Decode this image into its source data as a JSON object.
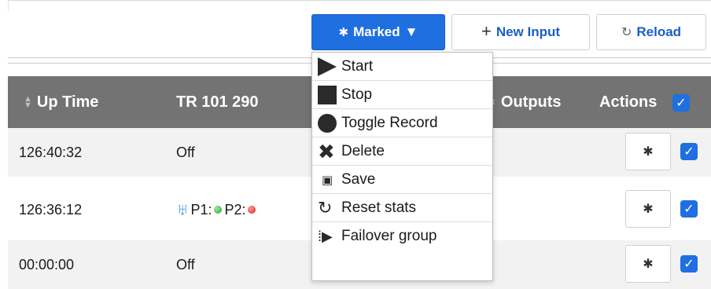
{
  "toolbar": {
    "marked_label": "Marked",
    "new_input_label": "New Input",
    "reload_label": "Reload"
  },
  "table": {
    "headers": {
      "uptime": "Up Time",
      "tr101290": "TR 101 290",
      "outputs": "Outputs",
      "actions": "Actions"
    },
    "rows": [
      {
        "uptime": "126:40:32",
        "tr101290": "Off",
        "checked": true
      },
      {
        "uptime": "126:36:12",
        "tr_p1": "P1:",
        "tr_p2": "P2:",
        "p1_status": "green",
        "p2_status": "red",
        "checked": true
      },
      {
        "uptime": "00:00:00",
        "tr101290": "Off",
        "checked": true
      }
    ]
  },
  "menu": {
    "items": [
      {
        "label": "Start",
        "icon": "play-icon"
      },
      {
        "label": "Stop",
        "icon": "stop-icon"
      },
      {
        "label": "Toggle Record",
        "icon": "record-icon"
      },
      {
        "label": "Delete",
        "icon": "delete-icon"
      },
      {
        "label": "Save",
        "icon": "save-icon"
      },
      {
        "label": "Reset stats",
        "icon": "reset-icon"
      },
      {
        "label": "Failover group",
        "icon": "failover-icon"
      }
    ]
  },
  "colors": {
    "accent": "#1f6fe0",
    "header_bg": "#737373",
    "status_green": "#2e9e2e",
    "status_red": "#d41c1c"
  }
}
